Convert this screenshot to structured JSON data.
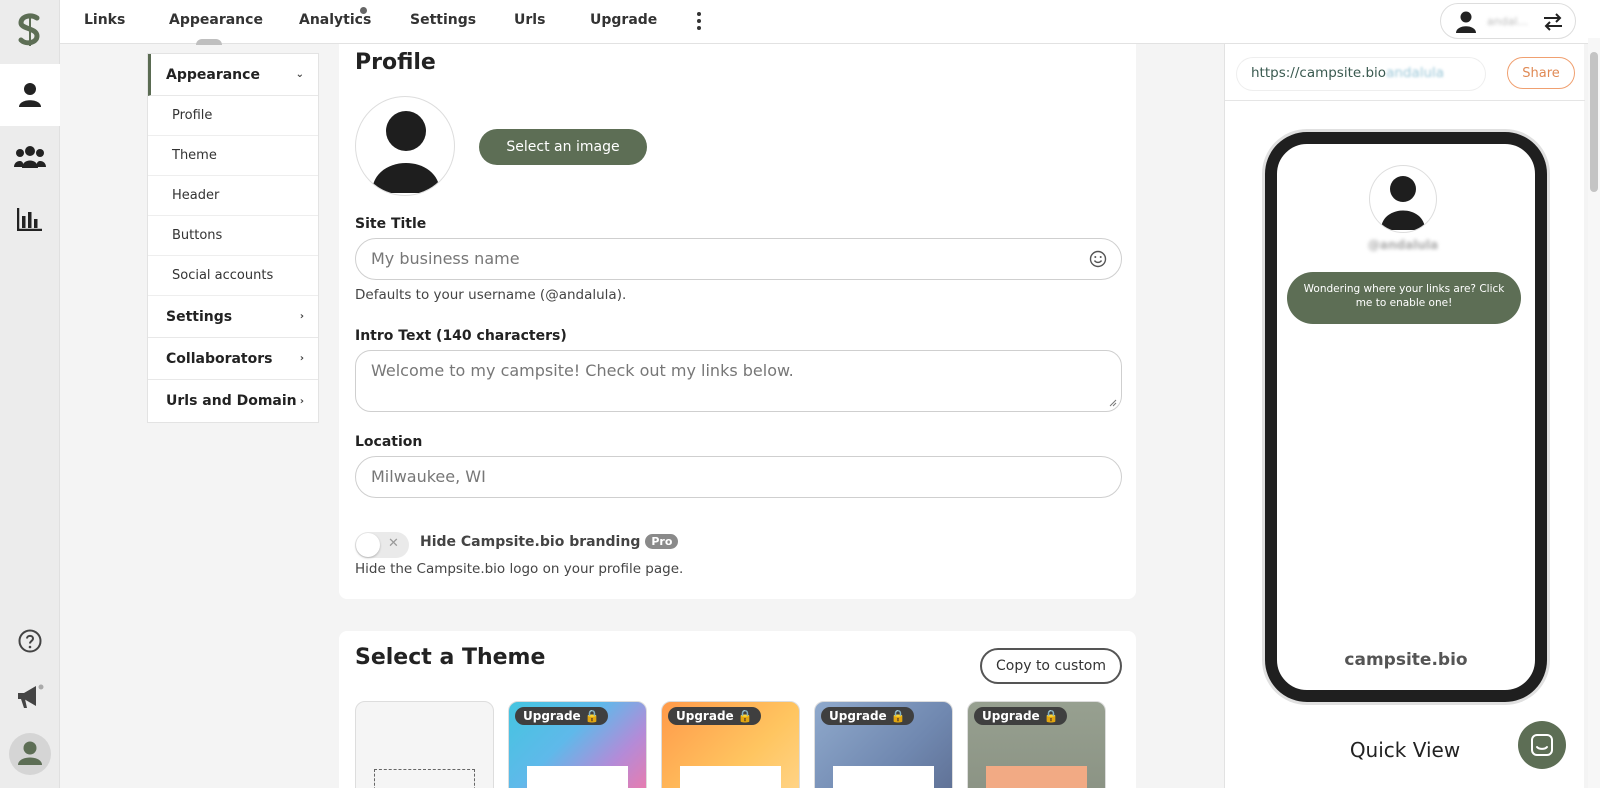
{
  "nav": {
    "items": [
      "Links",
      "Appearance",
      "Analytics",
      "Settings",
      "Urls",
      "Upgrade"
    ],
    "account_name": "andal..."
  },
  "subnav": {
    "appearance": "Appearance",
    "appearance_items": [
      "Profile",
      "Theme",
      "Header",
      "Buttons",
      "Social accounts"
    ],
    "settings": "Settings",
    "collaborators": "Collaborators",
    "urls_domain": "Urls and Domain"
  },
  "profile": {
    "title": "Profile",
    "select_image": "Select an image",
    "site_title_label": "Site Title",
    "site_title_placeholder": "My business name",
    "site_title_hint": "Defaults to your username (@andalula).",
    "intro_label": "Intro Text (140 characters)",
    "intro_placeholder": "Welcome to my campsite! Check out my links below.",
    "location_label": "Location",
    "location_placeholder": "Milwaukee, WI",
    "branding_label": "Hide Campsite.bio branding",
    "pro_badge": "Pro",
    "branding_hint": "Hide the Campsite.bio logo on your profile page."
  },
  "themes": {
    "title": "Select a Theme",
    "copy_button": "Copy to custom",
    "upgrade_label": "Upgrade"
  },
  "preview": {
    "url_prefix": "https://campsite.bio",
    "url_suffix": "andalula",
    "share": "Share",
    "username": "@andalula",
    "message": "Wondering where your links are? Click me to enable one!",
    "brand": "campsite.bio",
    "quick_view": "Quick View"
  },
  "colors": {
    "accent": "#5d6e55",
    "share": "#e08a55"
  }
}
